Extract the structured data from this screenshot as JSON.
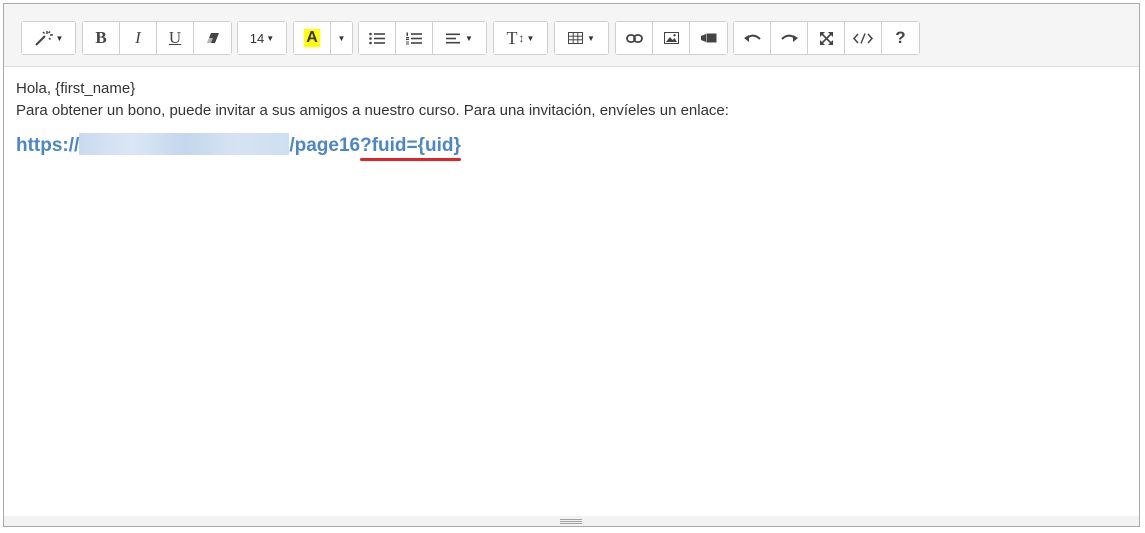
{
  "toolbar": {
    "font_size_label": "14",
    "bold_label": "B",
    "italic_label": "I",
    "underline_label": "U",
    "highlight_label": "A",
    "text_height_label": "T",
    "help_label": "?",
    "highlight_color": "#ffff00"
  },
  "content": {
    "greeting": "Hola, {first_name}",
    "message": "Para obtener un bono, puede invitar a sus amigos a nuestro curso.  Para una invitación, envíeles un enlace:",
    "link_prefix": "https://",
    "link_path": "/page16",
    "link_query": "?fuid={uid}"
  },
  "colors": {
    "link": "#4a86c8",
    "annotation": "#e02424"
  },
  "icons": [
    "magic-wand-icon",
    "eraser-icon",
    "bullet-list-icon",
    "numbered-list-icon",
    "align-icon",
    "table-icon",
    "link-icon",
    "image-icon",
    "video-icon",
    "undo-icon",
    "redo-icon",
    "fullscreen-icon",
    "code-view-icon"
  ]
}
